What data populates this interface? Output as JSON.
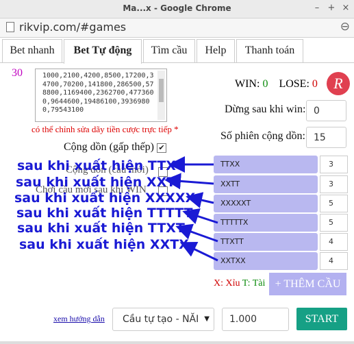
{
  "browser": {
    "window_title": "Ma...x - Google Chrome",
    "url": "rikvip.com/#games",
    "minimize_label": "–",
    "maximize_label": "+",
    "close_label": "×",
    "zoom_glyph": "⊖"
  },
  "tabs": [
    {
      "label": "Bet nhanh",
      "active": false
    },
    {
      "label": "Bet Tự động",
      "active": true
    },
    {
      "label": "Tìm cầu",
      "active": false
    },
    {
      "label": "Help",
      "active": false
    },
    {
      "label": "Thanh toán",
      "active": false
    }
  ],
  "left": {
    "counter": "30",
    "sequence": "1000,2100,4200,8500,17200,34700,70200,141800,286500,578800,1169400,2362700,4773600,9644600,19486100,39369800,79543100",
    "note": "có thể chỉnh sửa dãy tiền cược trực tiếp *",
    "cong_don_label": "Cộng dồn (gấp thếp)",
    "cong_don_checked": "✔",
    "cong_don_cau_moi_label": "Cộng dồn (cầu mới)",
    "choi_cau_moi_label": "Chơi cầu mới sau khi WIN"
  },
  "right": {
    "win_label": "WIN:",
    "win_value": "0",
    "lose_label": "LOSE:",
    "lose_value": "0",
    "logo_letter": "R",
    "stop_after_win_label": "Dừng sau khi win:",
    "stop_after_win_value": "0",
    "cumulative_sessions_label": "Số phiên cộng dồn:",
    "cumulative_sessions_value": "15"
  },
  "patterns": [
    {
      "pattern": "TTXX",
      "count": "3"
    },
    {
      "pattern": "XXTT",
      "count": "3"
    },
    {
      "pattern": "XXXXXT",
      "count": "5"
    },
    {
      "pattern": "TTTTTX",
      "count": "5"
    },
    {
      "pattern": "TTXTT",
      "count": "4"
    },
    {
      "pattern": "XXTXX",
      "count": "4"
    }
  ],
  "annotations": [
    "sau khi xuất hiện TTX",
    "sau khi xuất hiện XXT",
    "sau khi xuất hiện XXXXX",
    "sau khi xuất hiện TTTTT",
    "sau khi xuất hiện TTXT",
    "sau khi xuất hiện XXTX"
  ],
  "legend": {
    "x_label": "X: Xỉu",
    "t_label": "T: Tài",
    "x_color": "#d00000",
    "t_color": "#0a8a0a"
  },
  "buttons": {
    "add_pattern": "+ THÊM CẦU",
    "start": "START"
  },
  "bottom": {
    "guide_link": "xem hướng dẫn",
    "select_value": "Cầu tự tạo - NĂI",
    "amount_value": "1.000"
  },
  "colors": {
    "annotation_blue": "#1a1ad4",
    "start_green": "#16a085",
    "add_button": "#b3b1f0"
  }
}
